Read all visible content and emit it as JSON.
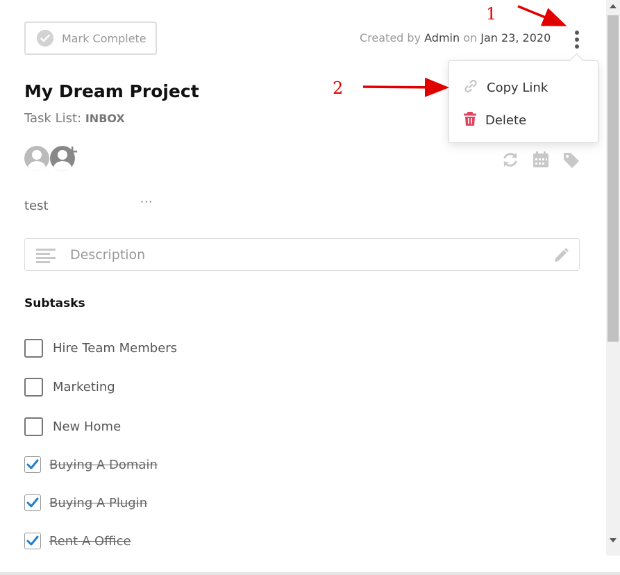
{
  "header": {
    "mark_complete_label": "Mark Complete",
    "created_by_prefix": "Created by",
    "created_by_user": "Admin",
    "created_on_prefix": "on",
    "created_date": "Jan 23, 2020"
  },
  "menu": {
    "copy_link_label": "Copy Link",
    "delete_label": "Delete"
  },
  "annotations": {
    "step_1": "1",
    "step_2": "2"
  },
  "task": {
    "title": "My Dream Project",
    "task_list_prefix": "Task List:",
    "task_list_name": "INBOX",
    "comment_text": "test",
    "comment_more": "···",
    "description_placeholder": "Description"
  },
  "subtasks": {
    "heading": "Subtasks",
    "items": [
      {
        "label": "Hire Team Members",
        "done": false
      },
      {
        "label": "Marketing",
        "done": false
      },
      {
        "label": "New Home",
        "done": false
      },
      {
        "label": "Buying A Domain",
        "done": true
      },
      {
        "label": "Buying A Plugin",
        "done": true
      },
      {
        "label": "Rent A Office",
        "done": true
      }
    ]
  },
  "colors": {
    "annotation": "#e00000",
    "delete_icon": "#e0455f",
    "check_blue": "#1f7fc8"
  }
}
